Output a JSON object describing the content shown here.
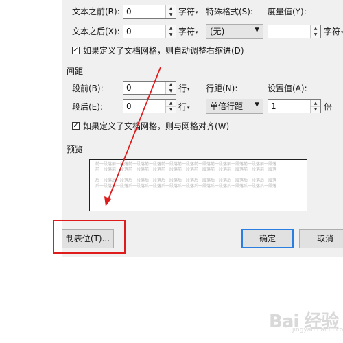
{
  "indent": {
    "before_text_label": "文本之前(R):",
    "before_text_value": "0",
    "after_text_label": "文本之后(X):",
    "after_text_value": "0",
    "unit": "字符",
    "special_format_label": "特殊格式(S):",
    "special_format_value": "(无)",
    "measure_label": "度量值(Y):",
    "measure_value": "",
    "measure_unit": "字符",
    "grid_checkbox_label": "如果定义了文档网格，则自动调整右缩进(D)",
    "grid_checkbox_checked": true
  },
  "spacing": {
    "section_title": "间距",
    "before_label": "段前(B):",
    "before_value": "0",
    "after_label": "段后(E):",
    "after_value": "0",
    "unit": "行",
    "line_spacing_label": "行距(N):",
    "line_spacing_value": "单倍行距",
    "setting_label": "设置值(A):",
    "setting_value": "1",
    "setting_unit": "倍",
    "grid_checkbox_label": "如果定义了文档网格，则与网格对齐(W)",
    "grid_checkbox_checked": true
  },
  "preview": {
    "title": "预览",
    "line_prev": "前一段落前一段落前一段落前一段落前一段落前一段落前一段落前一段落前一段落前一段落前一段落",
    "line_prev2": "前一段落前一段落前一段落前一段落前一段落前一段落前一段落前一段落前一段落前一段落前一段落",
    "line_after": "后一段落后一段落后一段落后一段落后一段落后一段落后一段落后一段落后一段落后一段落后一段落",
    "line_after2": "后一段落后一段落后一段落后一段落后一段落后一段落后一段落后一段落后一段落后一段落后一段落"
  },
  "buttons": {
    "tabs_label": "制表位(T)...",
    "ok_label": "确定",
    "cancel_label": "取消"
  },
  "watermark": {
    "brand": "Bai 经验",
    "url": "jingyan.baidu.com"
  },
  "icons": {
    "spin_up": "▲",
    "spin_down": "▼",
    "dropdown": "▼",
    "unit_arrow": "▾",
    "check": "✓"
  },
  "colors": {
    "annotation": "#e01b1b",
    "default_button_border": "#2a7de1"
  }
}
